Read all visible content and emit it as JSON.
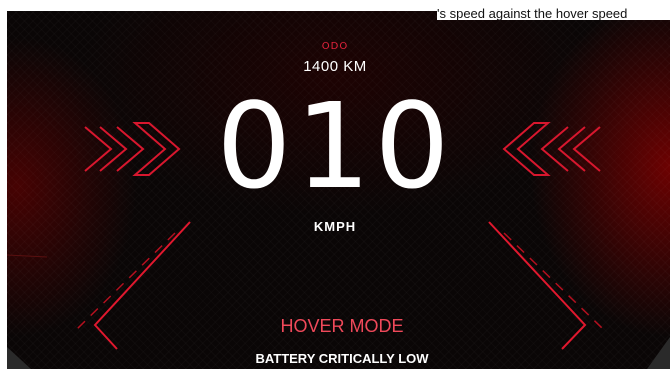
{
  "header": {
    "partial_text": "'s speed against the hover speed"
  },
  "odometer": {
    "label": "ODO",
    "value": "1400 KM"
  },
  "speed": {
    "value": "010",
    "unit": "KMPH"
  },
  "mode": {
    "label": "HOVER MODE"
  },
  "alert": {
    "message": "BATTERY CRITICALLY LOW"
  },
  "colors": {
    "accent": "#e0223a",
    "mode": "#f0495a",
    "background": "#0a0606",
    "text": "#ffffff"
  },
  "icons": {
    "left_indicator": "chevron-right-icon",
    "right_indicator": "chevron-left-icon"
  }
}
